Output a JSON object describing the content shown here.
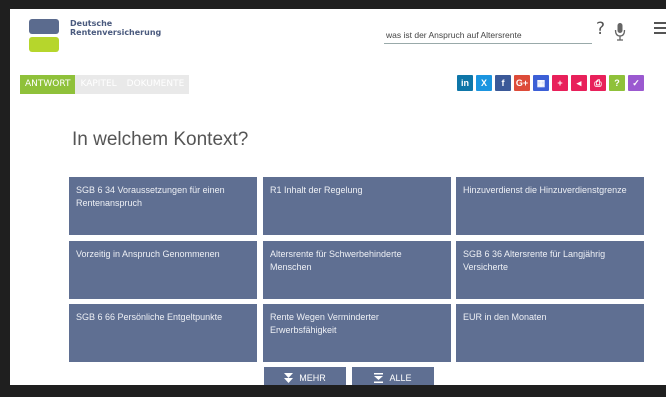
{
  "header": {
    "brand_line1": "Deutsche",
    "brand_line2": "Rentenversicherung",
    "search_value": "was ist der Anspruch auf Altersrente",
    "help_label": "?"
  },
  "tabs": [
    {
      "label": "ANTWORT"
    },
    {
      "label": "KAPITEL"
    },
    {
      "label": "DOKUMENTE"
    }
  ],
  "share": [
    {
      "label": "in",
      "color": "#0e76a8",
      "name": "linkedin-icon"
    },
    {
      "label": "X",
      "color": "#1b95e0",
      "name": "xing-icon"
    },
    {
      "label": "f",
      "color": "#3b5998",
      "name": "facebook-icon"
    },
    {
      "label": "G+",
      "color": "#dd4b39",
      "name": "google-plus-icon"
    },
    {
      "label": "▦",
      "color": "#3c5fd6",
      "name": "grid-share-icon"
    },
    {
      "label": "+",
      "color": "#e8205a",
      "name": "add-share-icon"
    },
    {
      "label": "◂",
      "color": "#e8205a",
      "name": "back-share-icon"
    },
    {
      "label": "⎙",
      "color": "#e8205a",
      "name": "print-icon"
    },
    {
      "label": "?",
      "color": "#8fc13a",
      "name": "question-icon"
    },
    {
      "label": "✓",
      "color": "#9b59d0",
      "name": "check-icon"
    }
  ],
  "title": "In welchem Kontext?",
  "cards": [
    {
      "label": "SGB 6 34 Voraussetzungen für einen Rentenanspruch"
    },
    {
      "label": "R1 Inhalt der Regelung"
    },
    {
      "label": "Hinzuverdienst die Hinzuverdienstgrenze"
    },
    {
      "label": "Vorzeitig in Anspruch Genommenen"
    },
    {
      "label": "Altersrente für Schwerbehinderte Menschen"
    },
    {
      "label": "SGB 6 36 Altersrente für Langjährig Versicherte"
    },
    {
      "label": "SGB 6 66 Persönliche Entgeltpunkte"
    },
    {
      "label": "Rente Wegen Verminderter Erwerbsfähigkeit"
    },
    {
      "label": "EUR in den Monaten"
    }
  ],
  "buttons": {
    "mehr": "MEHR",
    "alle": "ALLE"
  }
}
